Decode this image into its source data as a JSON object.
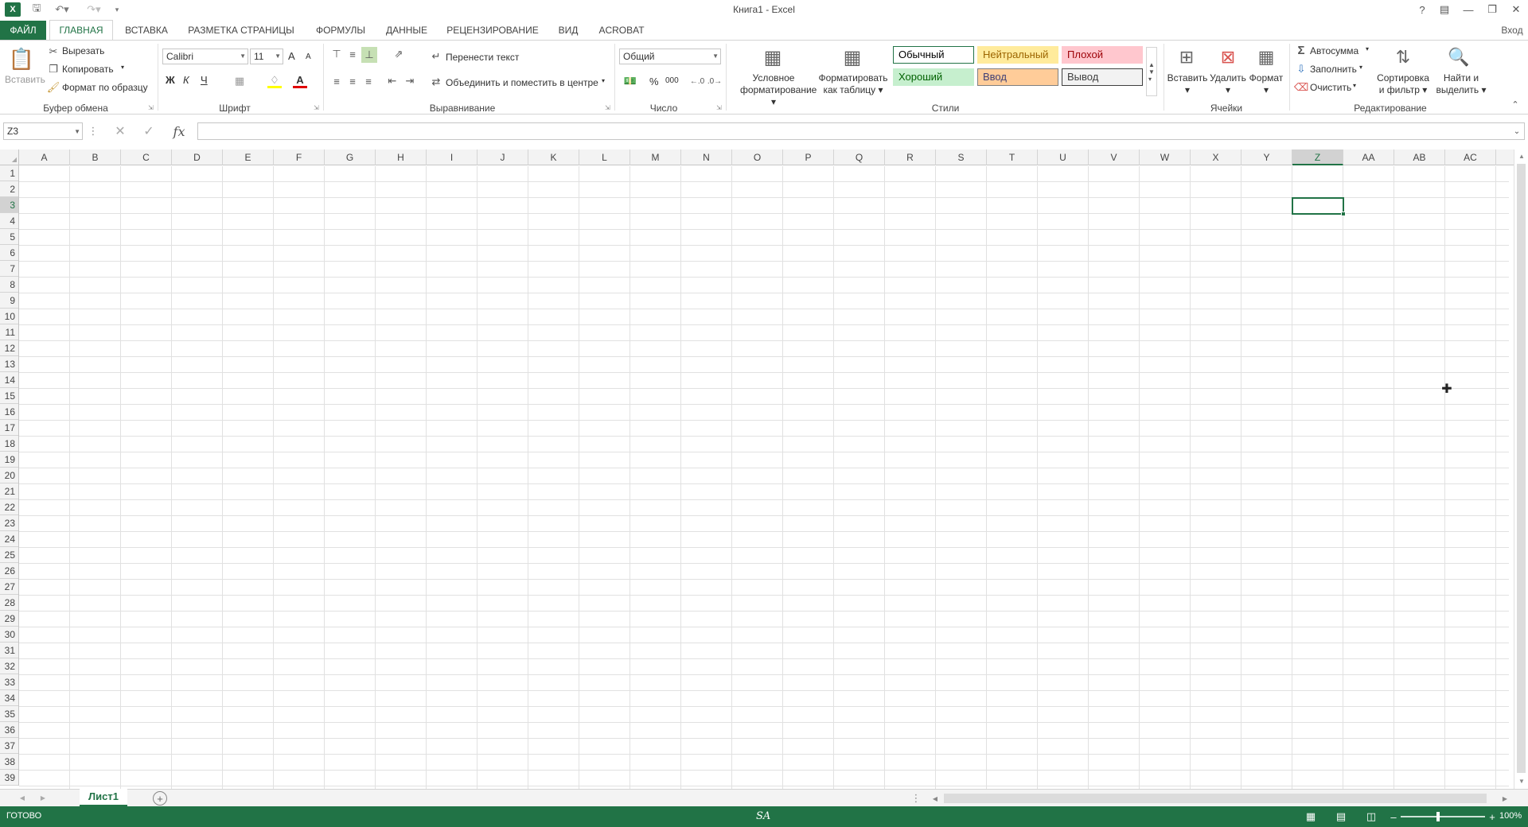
{
  "window": {
    "title": "Книга1 - Excel",
    "signin": "Вход"
  },
  "tabs": [
    {
      "label": "ФАЙЛ",
      "kind": "file"
    },
    {
      "label": "ГЛАВНАЯ",
      "kind": "active"
    },
    {
      "label": "ВСТАВКА",
      "kind": ""
    },
    {
      "label": "РАЗМЕТКА СТРАНИЦЫ",
      "kind": ""
    },
    {
      "label": "ФОРМУЛЫ",
      "kind": ""
    },
    {
      "label": "ДАННЫЕ",
      "kind": ""
    },
    {
      "label": "РЕЦЕНЗИРОВАНИЕ",
      "kind": ""
    },
    {
      "label": "ВИД",
      "kind": ""
    },
    {
      "label": "ACROBAT",
      "kind": ""
    }
  ],
  "ribbon": {
    "clipboard": {
      "label": "Буфер обмена",
      "paste": "Вставить",
      "cut": "Вырезать",
      "copy": "Копировать",
      "format_painter": "Формат по образцу"
    },
    "font": {
      "label": "Шрифт",
      "name": "Calibri",
      "size": "11",
      "bold": "Ж",
      "italic": "К",
      "underline": "Ч",
      "grow": "A",
      "shrink": "A"
    },
    "alignment": {
      "label": "Выравнивание",
      "wrap": "Перенести текст",
      "merge": "Объединить и поместить в центре"
    },
    "number": {
      "label": "Число",
      "format": "Общий",
      "percent": "%",
      "thousands": "000"
    },
    "styles": {
      "label": "Стили",
      "cond_fmt_1": "Условное",
      "cond_fmt_2": "форматирование",
      "fmt_table_1": "Форматировать",
      "fmt_table_2": "как таблицу",
      "items": [
        {
          "label": "Обычный",
          "bg": "#ffffff",
          "fg": "#000000",
          "border": "#217346"
        },
        {
          "label": "Нейтральный",
          "bg": "#ffeb9c",
          "fg": "#9c6500",
          "border": "#ffeb9c"
        },
        {
          "label": "Плохой",
          "bg": "#ffc7ce",
          "fg": "#9c0006",
          "border": "#ffc7ce"
        },
        {
          "label": "Хороший",
          "bg": "#c6efce",
          "fg": "#006100",
          "border": "#c6efce"
        },
        {
          "label": "Ввод",
          "bg": "#ffcc99",
          "fg": "#3f3f76",
          "border": "#7f7f7f"
        },
        {
          "label": "Вывод",
          "bg": "#f2f2f2",
          "fg": "#3f3f3f",
          "border": "#3f3f3f"
        }
      ]
    },
    "cells": {
      "label": "Ячейки",
      "insert": "Вставить",
      "delete": "Удалить",
      "format": "Формат"
    },
    "editing": {
      "label": "Редактирование",
      "autosum": "Автосумма",
      "fill": "Заполнить",
      "clear": "Очистить",
      "sort_1": "Сортировка",
      "sort_2": "и фильтр",
      "find_1": "Найти и",
      "find_2": "выделить"
    }
  },
  "formula_bar": {
    "name_box": "Z3",
    "fx": "fx",
    "value": ""
  },
  "columns": [
    "A",
    "B",
    "C",
    "D",
    "E",
    "F",
    "G",
    "H",
    "I",
    "J",
    "K",
    "L",
    "M",
    "N",
    "O",
    "P",
    "Q",
    "R",
    "S",
    "T",
    "U",
    "V",
    "W",
    "X",
    "Y",
    "Z",
    "AA",
    "AB",
    "AC"
  ],
  "rows": [
    "1",
    "2",
    "3",
    "4",
    "5",
    "6",
    "7",
    "8",
    "9",
    "10",
    "11",
    "12",
    "13",
    "14",
    "15",
    "16",
    "17",
    "18",
    "19",
    "20",
    "21",
    "22",
    "23",
    "24",
    "25",
    "26",
    "27",
    "28",
    "29",
    "30",
    "31",
    "32",
    "33",
    "34",
    "35",
    "36",
    "37",
    "38",
    "39"
  ],
  "selected": {
    "column": "Z",
    "row": "3"
  },
  "sheets": [
    {
      "label": "Лист1",
      "active": true
    }
  ],
  "status": {
    "mode": "ГОТОВО",
    "center": "SA",
    "zoom": "100%"
  },
  "colors": {
    "accent": "#217346"
  }
}
